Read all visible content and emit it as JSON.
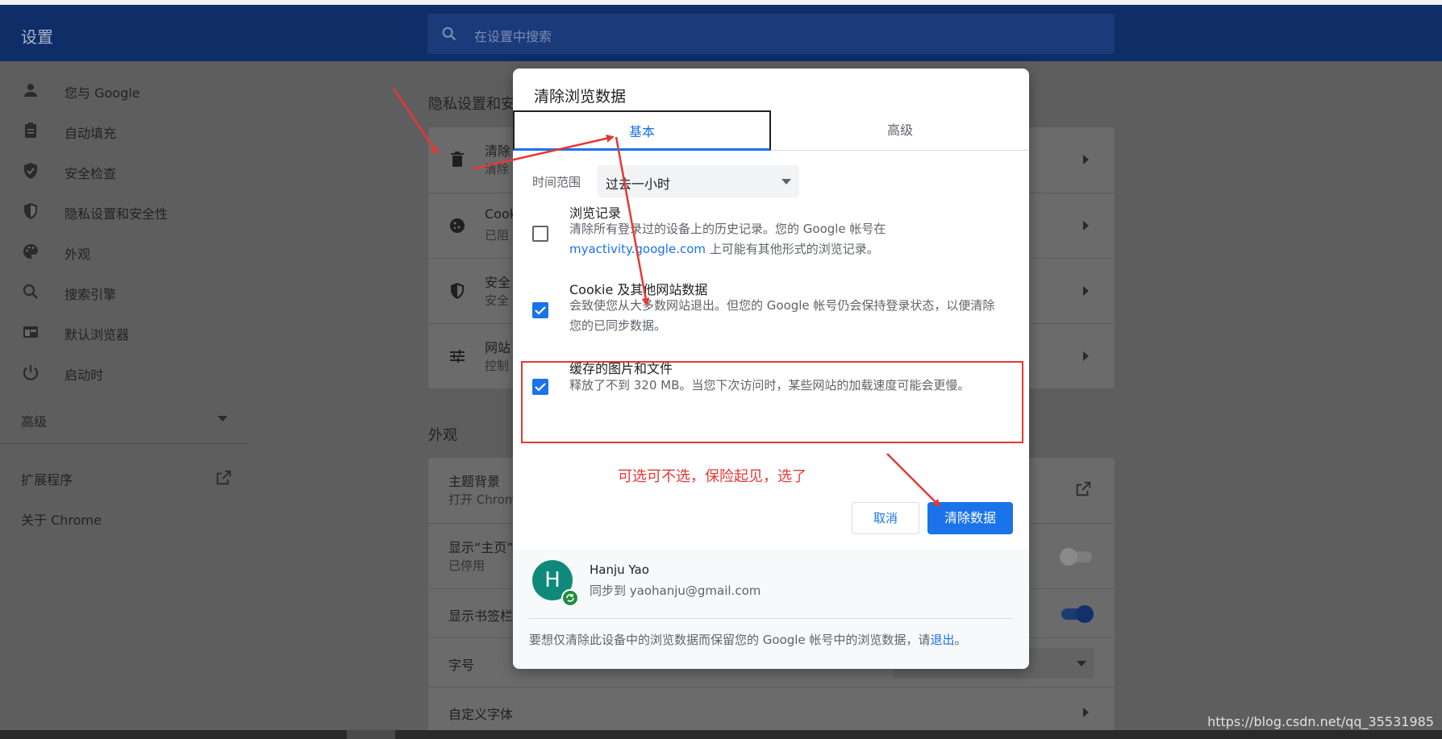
{
  "page": {
    "title": "设置",
    "search_placeholder": "在设置中搜索",
    "watermark": "https://blog.csdn.net/qq_35531985"
  },
  "sidebar": {
    "items": [
      {
        "label": "您与 Google",
        "icon": "person-icon"
      },
      {
        "label": "自动填充",
        "icon": "clipboard-icon"
      },
      {
        "label": "安全检查",
        "icon": "shield-check-icon"
      },
      {
        "label": "隐私设置和安全性",
        "icon": "shield-icon"
      },
      {
        "label": "外观",
        "icon": "palette-icon"
      },
      {
        "label": "搜索引擎",
        "icon": "search-icon"
      },
      {
        "label": "默认浏览器",
        "icon": "browser-icon"
      },
      {
        "label": "启动时",
        "icon": "power-icon"
      }
    ],
    "advanced": "高级",
    "extensions": "扩展程序",
    "about": "关于 Chrome"
  },
  "main": {
    "privacy_section": "隐私设置和安",
    "privacy_rows": [
      {
        "title": "清除",
        "sub": "清除"
      },
      {
        "title": "Cook",
        "sub": "已阻"
      },
      {
        "title": "安全",
        "sub": "安全"
      },
      {
        "title": "网站",
        "sub": "控制"
      }
    ],
    "appearance_section": "外观",
    "appearance_rows": [
      {
        "title": "主题背景",
        "sub": "打开 Chrom"
      },
      {
        "title": "显示“主页”",
        "sub": "已停用"
      },
      {
        "title": "显示书签栏",
        "sub": ""
      },
      {
        "title": "字号",
        "sub": ""
      },
      {
        "title": "自定义字体",
        "sub": ""
      }
    ]
  },
  "dialog": {
    "title": "清除浏览数据",
    "tabs": [
      "基本",
      "高级"
    ],
    "active_tab": "基本",
    "time_range_label": "时间范围",
    "time_range_value": "过去一小时",
    "options": [
      {
        "title": "浏览记录",
        "desc_part1": "清除所有登录过的设备上的历史记录。您的 Google 帐号在",
        "desc_link": "myactivity.google.com",
        "desc_part2": " 上可能有其他形式的浏览记录。",
        "checked": false
      },
      {
        "title": "Cookie 及其他网站数据",
        "desc": "会致使您从大多数网站退出。但您的 Google 帐号仍会保持登录状态，以便清除您的已同步数据。",
        "checked": true
      },
      {
        "title": "缓存的图片和文件",
        "desc": "释放了不到 320 MB。当您下次访问时，某些网站的加载速度可能会更慢。",
        "checked": true
      }
    ],
    "annotation_note": "可选可不选，保险起见，选了",
    "cancel_label": "取消",
    "clear_label": "清除数据",
    "account": {
      "avatar_letter": "H",
      "name": "Hanju Yao",
      "sync_text": "同步到 yaohanju@gmail.com"
    },
    "footer_text": "要想仅清除此设备中的浏览数据而保留您的 Google 帐号中的浏览数据，请",
    "footer_link": "退出",
    "footer_end": "。"
  },
  "colors": {
    "accent": "#1a73e8",
    "header": "#0f2d66",
    "annotation": "#e53935"
  }
}
